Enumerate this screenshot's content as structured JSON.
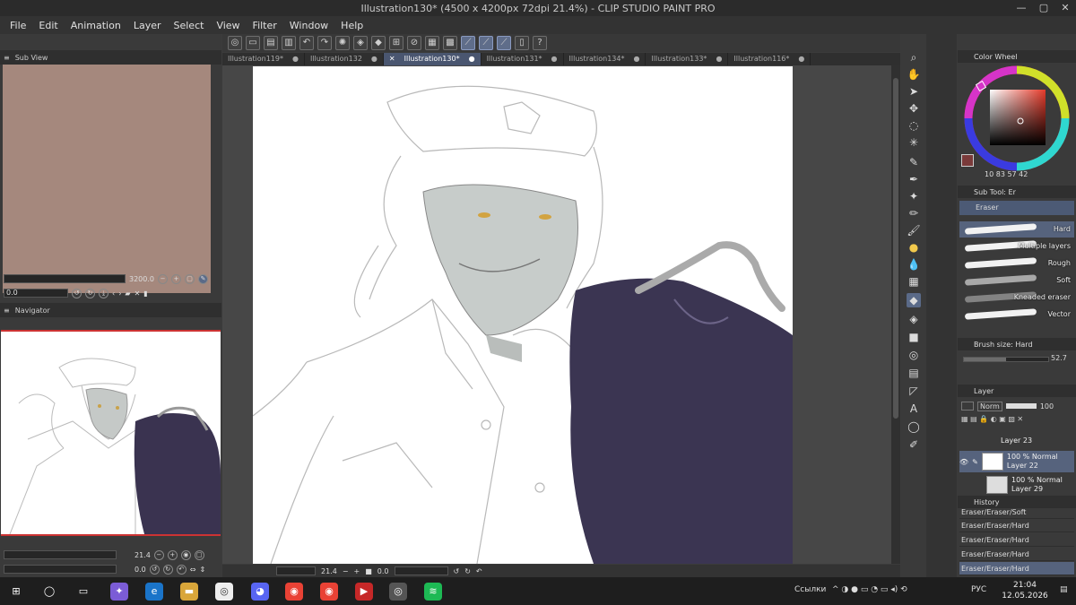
{
  "window": {
    "title": "Illustration130* (4500 x 4200px 72dpi 21.4%) - CLIP STUDIO PAINT PRO",
    "minimize": "—",
    "maximize": "▢",
    "close": "✕"
  },
  "menu": [
    "File",
    "Edit",
    "Animation",
    "Layer",
    "Select",
    "View",
    "Filter",
    "Window",
    "Help"
  ],
  "tabs": [
    {
      "label": "Illustration119*",
      "active": false
    },
    {
      "label": "Illustration132",
      "active": false
    },
    {
      "label": "Illustration130*",
      "active": true
    },
    {
      "label": "Illustration131*",
      "active": false
    },
    {
      "label": "Illustration134*",
      "active": false
    },
    {
      "label": "Illustration133*",
      "active": false
    },
    {
      "label": "Illustration116*",
      "active": false
    }
  ],
  "subview": {
    "title": "Sub View",
    "zoom": "3200.0",
    "rotation": "0.0",
    "color": "#a5887d"
  },
  "navigator": {
    "title": "Navigator",
    "zoom": "21.4",
    "rotation": "0.0"
  },
  "canvas_status": {
    "zoom": "21.4",
    "rotation": "0.0"
  },
  "color_wheel": {
    "title": "Color Wheel",
    "values": "10  83  57  42",
    "main_color": "#c44438"
  },
  "sub_tool": {
    "title": "Sub Tool: Er",
    "group": "Eraser",
    "brushes": [
      {
        "label": "Hard",
        "selected": true
      },
      {
        "label": "Multiple layers",
        "selected": false
      },
      {
        "label": "Rough",
        "selected": false
      },
      {
        "label": "Soft",
        "selected": false
      },
      {
        "label": "Kneaded eraser",
        "selected": false
      },
      {
        "label": "Vector",
        "selected": false
      }
    ]
  },
  "brush_size": {
    "title": "Brush size: Hard",
    "value": "52.7",
    "fraction": 0.5
  },
  "layer_panel": {
    "title": "Layer",
    "blend": "Norm",
    "opacity": "100",
    "layers": [
      {
        "line1": "Layer 23",
        "line2": "",
        "selected": false
      },
      {
        "line1": "100 % Normal",
        "line2": "Layer 22",
        "selected": true
      },
      {
        "line1": "100 % Normal",
        "line2": "Layer 29",
        "selected": false
      }
    ]
  },
  "history": {
    "title": "History",
    "items": [
      "Eraser/Eraser/Soft",
      "Eraser/Eraser/Hard",
      "Eraser/Eraser/Hard",
      "Eraser/Eraser/Hard",
      "Eraser/Eraser/Hard"
    ]
  },
  "taskbar": {
    "links_label": "Ссылки",
    "lang": "РУС",
    "time": "21:04",
    "date": "12.05.2026"
  }
}
